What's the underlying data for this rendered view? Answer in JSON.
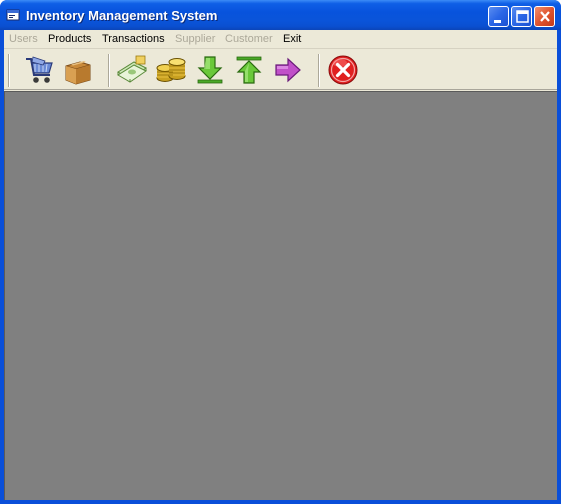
{
  "window": {
    "title": "Inventory Management System"
  },
  "menu": [
    {
      "label": "Users",
      "enabled": false
    },
    {
      "label": "Products",
      "enabled": true
    },
    {
      "label": "Transactions",
      "enabled": true
    },
    {
      "label": "Supplier",
      "enabled": false
    },
    {
      "label": "Customer",
      "enabled": false
    },
    {
      "label": "Exit",
      "enabled": true
    }
  ],
  "toolbar": {
    "buttons": [
      {
        "icon": "shopping-cart-icon"
      },
      {
        "icon": "box-icon"
      },
      {
        "icon": "money-icon"
      },
      {
        "icon": "coins-icon"
      },
      {
        "icon": "down-arrow-icon"
      },
      {
        "icon": "up-arrow-icon"
      },
      {
        "icon": "right-arrow-icon"
      },
      {
        "icon": "exit-icon"
      }
    ]
  },
  "colors": {
    "titlebar": "#0a54d9",
    "workspace": "#808080",
    "menu_disabled": "#aca899",
    "close_red": "#e0542f"
  }
}
